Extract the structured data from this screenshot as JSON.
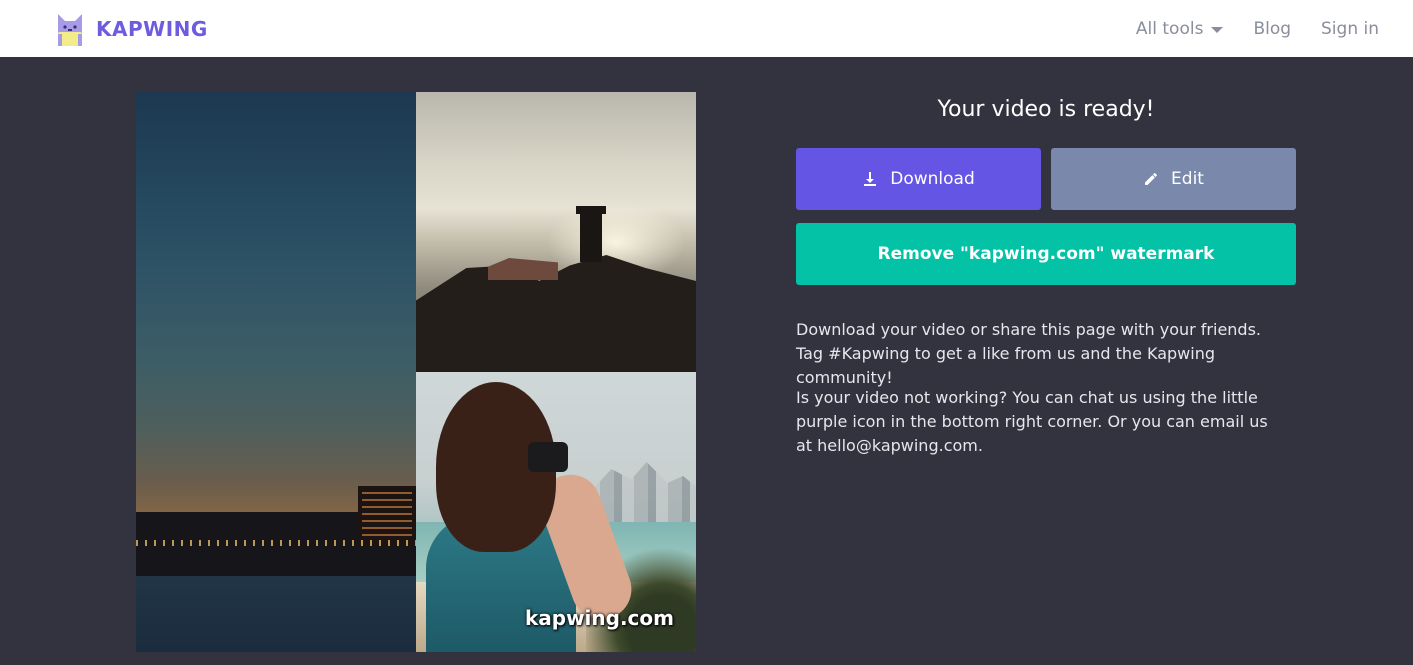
{
  "header": {
    "logo_text": "KAPWING",
    "nav": [
      {
        "label": "All tools",
        "has_caret": true
      },
      {
        "label": "Blog"
      },
      {
        "label": "Sign in"
      }
    ]
  },
  "video": {
    "watermark": "kapwing.com"
  },
  "ready": {
    "title": "Your video is ready!",
    "download_label": "Download",
    "edit_label": "Edit",
    "remove_watermark_label": "Remove \"kapwing.com\" watermark",
    "info_1": "Download your video or share this page with your friends. Tag #Kapwing to get a like from us and the Kapwing community!",
    "info_2": "Is your video not working? You can chat us using the little purple icon in the bottom right corner. Or you can email us at hello@kapwing.com."
  },
  "colors": {
    "brand": "#6d5be0",
    "download": "#6455e4",
    "edit": "#7a89ab",
    "remove": "#03c2a6",
    "background": "#33333f"
  }
}
